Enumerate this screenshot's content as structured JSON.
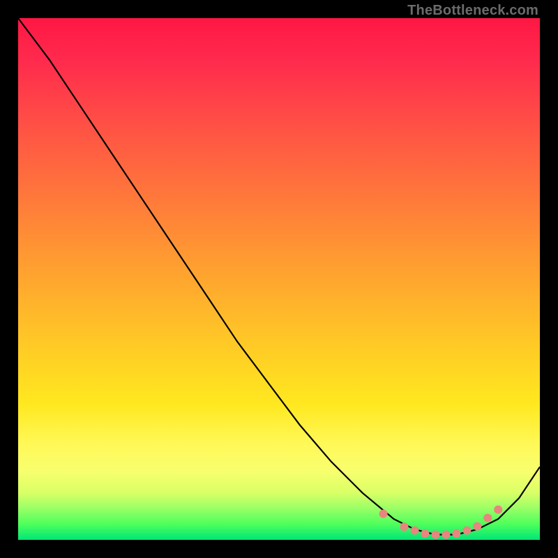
{
  "watermark": "TheBottleneck.com",
  "colors": {
    "marker": "#e9857f",
    "curve": "#000000"
  },
  "chart_data": {
    "type": "line",
    "title": "",
    "xlabel": "",
    "ylabel": "",
    "xlim": [
      0,
      100
    ],
    "ylim": [
      0,
      100
    ],
    "grid": false,
    "series": [
      {
        "name": "bottleneck-curve",
        "x": [
          0,
          6,
          12,
          18,
          24,
          30,
          36,
          42,
          48,
          54,
          60,
          66,
          72,
          76,
          80,
          84,
          88,
          92,
          96,
          100
        ],
        "y": [
          100,
          92,
          83,
          74,
          65,
          56,
          47,
          38,
          30,
          22,
          15,
          9,
          4,
          2,
          1,
          1,
          2,
          4,
          8,
          14
        ]
      }
    ],
    "markers": {
      "name": "highlighted-points",
      "x": [
        70,
        74,
        76,
        78,
        80,
        82,
        84,
        86,
        88,
        90,
        92
      ],
      "y": [
        5.0,
        2.5,
        1.8,
        1.2,
        1.0,
        1.0,
        1.2,
        1.8,
        2.6,
        4.2,
        5.8
      ]
    }
  }
}
